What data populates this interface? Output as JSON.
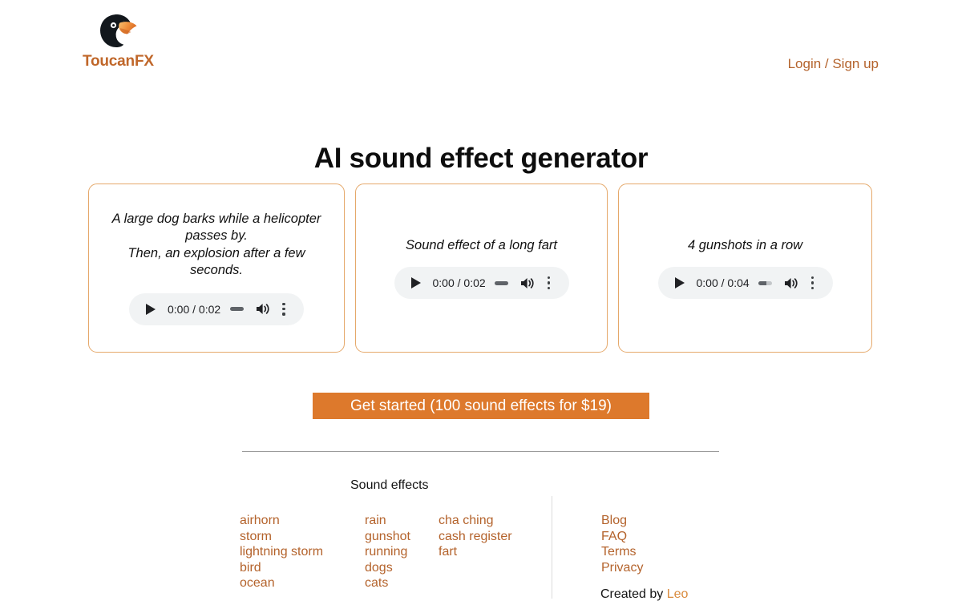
{
  "header": {
    "brand_name": "ToucanFX",
    "logo_icon": "toucan-logo",
    "auth_link": "Login / Sign up"
  },
  "hero": {
    "title": "AI sound effect generator"
  },
  "samples": [
    {
      "prompt": "A large dog barks while a helicopter passes by.\nThen, an explosion after a few seconds.",
      "player": {
        "play_icon": "play-icon",
        "time": "0:00 / 0:02",
        "current_time": "0:00",
        "duration": "0:02",
        "volume_icon": "volume-high-icon",
        "menu_icon": "more-vertical-icon"
      }
    },
    {
      "prompt": "Sound effect of a long fart",
      "player": {
        "play_icon": "play-icon",
        "time": "0:00 / 0:02",
        "current_time": "0:00",
        "duration": "0:02",
        "volume_icon": "volume-high-icon",
        "menu_icon": "more-vertical-icon"
      }
    },
    {
      "prompt": "4 gunshots in a row",
      "player": {
        "play_icon": "play-icon",
        "time": "0:00 / 0:04",
        "current_time": "0:00",
        "duration": "0:04",
        "volume_icon": "volume-high-icon",
        "menu_icon": "more-vertical-icon"
      }
    }
  ],
  "cta": {
    "label": "Get started (100 sound effects for $19)"
  },
  "footer": {
    "heading": "Sound effects",
    "columns": [
      {
        "items": [
          "airhorn",
          "storm",
          "lightning storm",
          "bird",
          "ocean"
        ]
      },
      {
        "items": [
          "rain",
          "gunshot",
          "running",
          "dogs",
          "cats"
        ]
      },
      {
        "items": [
          "cha ching",
          "cash register",
          "fart"
        ]
      }
    ],
    "links": [
      "Blog",
      "FAQ",
      "Terms",
      "Privacy"
    ],
    "credit_prefix": "Created by ",
    "credit_name": "Leo"
  },
  "colors": {
    "brand": "#c0672a",
    "link": "#b4632c",
    "cta_bg": "#dd792c",
    "card_border": "#e5a86a",
    "player_bg": "#f1f3f4"
  }
}
